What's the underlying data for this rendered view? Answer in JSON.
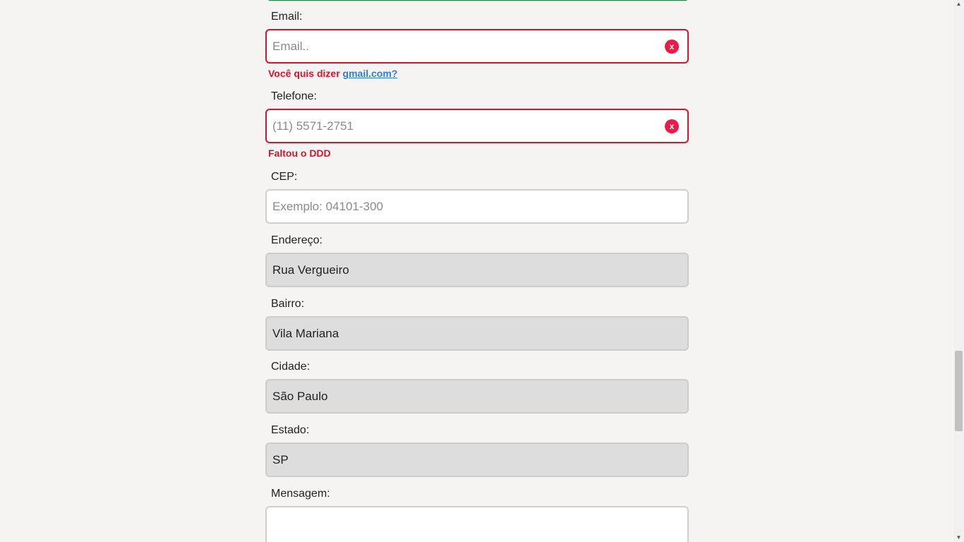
{
  "form": {
    "email": {
      "label": "Email:",
      "placeholder": "Email..",
      "clear_icon": "x",
      "error_prefix": "Você quis dizer ",
      "suggestion": "gmail.com?"
    },
    "telefone": {
      "label": "Telefone:",
      "placeholder": "(11) 5571-2751",
      "clear_icon": "x",
      "error": "Faltou o DDD"
    },
    "cep": {
      "label": "CEP:",
      "placeholder": "Exemplo: 04101-300"
    },
    "endereco": {
      "label": "Endereço:",
      "value": "Rua Vergueiro"
    },
    "bairro": {
      "label": "Bairro:",
      "value": "Vila Mariana"
    },
    "cidade": {
      "label": "Cidade:",
      "value": "São Paulo"
    },
    "estado": {
      "label": "Estado:",
      "value": "SP"
    },
    "mensagem": {
      "label": "Mensagem:",
      "value": ""
    }
  },
  "colors": {
    "error": "#e0112b",
    "link": "#2d7be5",
    "readonly_bg": "#dddddd",
    "page_bg": "#f5f4f2",
    "clear_button": "#ee1a44"
  }
}
